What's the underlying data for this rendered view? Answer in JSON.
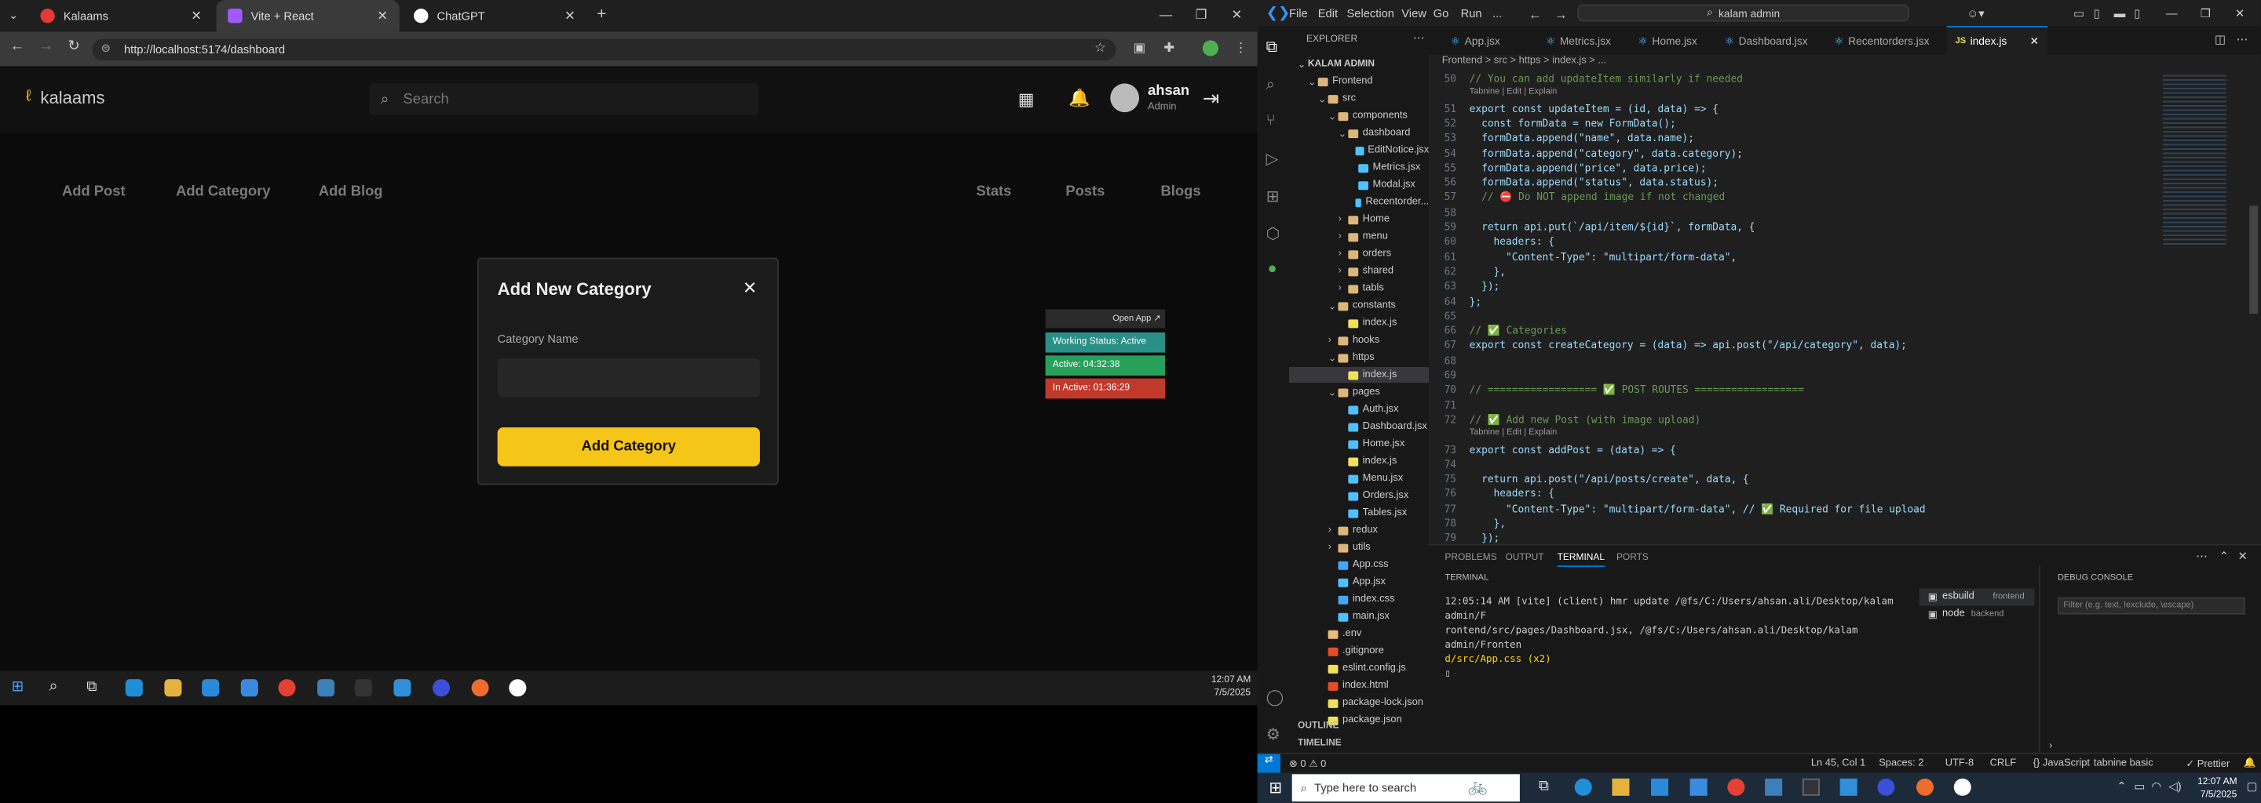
{
  "browser": {
    "tabs": [
      {
        "title": "Kalaams",
        "close": "✕"
      },
      {
        "title": "Vite + React",
        "close": "✕"
      },
      {
        "title": "ChatGPT",
        "close": "✕"
      }
    ],
    "new_tab": "+",
    "url": "http://localhost:5174/dashboard"
  },
  "app": {
    "logo": "kalaams",
    "search_placeholder": "Search",
    "user_name": "ahsan",
    "user_role": "Admin",
    "nav_left": [
      "Add Post",
      "Add Category",
      "Add Blog"
    ],
    "nav_right": [
      "Stats",
      "Posts",
      "Blogs"
    ],
    "modal": {
      "title": "Add New Category",
      "close": "✕",
      "label": "Category Name",
      "value": "",
      "button": "Add Category"
    },
    "widget": {
      "open_app": "Open App ↗",
      "status": "Working Status: Active",
      "active": "Active: 04:32:38",
      "inactive": "In Active: 01:36:29"
    },
    "colors": {
      "accent": "#f5c518",
      "green": "#27a05a",
      "red": "#c0392b",
      "teal": "#2a8f87"
    }
  },
  "taskbar_left": {
    "time": "12:07 AM",
    "date": "7/5/2025"
  },
  "vscode": {
    "menu": [
      "File",
      "Edit",
      "Selection",
      "View",
      "Go",
      "Run",
      "..."
    ],
    "search": "kalam admin",
    "tabs": [
      "App.jsx",
      "Metrics.jsx",
      "Home.jsx",
      "Dashboard.jsx",
      "Recentorders.jsx",
      "index.js"
    ],
    "breadcrumb": "Frontend > src > https > index.js > ...",
    "explorer_title": "EXPLORER",
    "tree": [
      {
        "d": 0,
        "t": "KALAM ADMIN",
        "k": "root"
      },
      {
        "d": 1,
        "t": "Frontend",
        "k": "folder"
      },
      {
        "d": 2,
        "t": "src",
        "k": "folder"
      },
      {
        "d": 3,
        "t": "components",
        "k": "folder"
      },
      {
        "d": 4,
        "t": "dashboard",
        "k": "folder"
      },
      {
        "d": 5,
        "t": "EditNotice.jsx",
        "k": "jsx"
      },
      {
        "d": 5,
        "t": "Metrics.jsx",
        "k": "jsx"
      },
      {
        "d": 5,
        "t": "Modal.jsx",
        "k": "jsx"
      },
      {
        "d": 5,
        "t": "Recentorder...",
        "k": "jsx"
      },
      {
        "d": 4,
        "t": "Home",
        "k": "folderc"
      },
      {
        "d": 4,
        "t": "menu",
        "k": "folderc"
      },
      {
        "d": 4,
        "t": "orders",
        "k": "folderc"
      },
      {
        "d": 4,
        "t": "shared",
        "k": "folderc"
      },
      {
        "d": 4,
        "t": "tabls",
        "k": "folderc"
      },
      {
        "d": 3,
        "t": "constants",
        "k": "folder"
      },
      {
        "d": 4,
        "t": "index.js",
        "k": "js"
      },
      {
        "d": 3,
        "t": "hooks",
        "k": "folderc"
      },
      {
        "d": 3,
        "t": "https",
        "k": "folder"
      },
      {
        "d": 4,
        "t": "index.js",
        "k": "js",
        "sel": true
      },
      {
        "d": 3,
        "t": "pages",
        "k": "folder"
      },
      {
        "d": 4,
        "t": "Auth.jsx",
        "k": "jsx"
      },
      {
        "d": 4,
        "t": "Dashboard.jsx",
        "k": "jsx"
      },
      {
        "d": 4,
        "t": "Home.jsx",
        "k": "jsx"
      },
      {
        "d": 4,
        "t": "index.js",
        "k": "js"
      },
      {
        "d": 4,
        "t": "Menu.jsx",
        "k": "jsx"
      },
      {
        "d": 4,
        "t": "Orders.jsx",
        "k": "jsx"
      },
      {
        "d": 4,
        "t": "Tables.jsx",
        "k": "jsx"
      },
      {
        "d": 3,
        "t": "redux",
        "k": "folderc"
      },
      {
        "d": 3,
        "t": "utils",
        "k": "folderc"
      },
      {
        "d": 3,
        "t": "App.css",
        "k": "css"
      },
      {
        "d": 3,
        "t": "App.jsx",
        "k": "jsx"
      },
      {
        "d": 3,
        "t": "index.css",
        "k": "css"
      },
      {
        "d": 3,
        "t": "main.jsx",
        "k": "jsx"
      },
      {
        "d": 2,
        "t": ".env",
        "k": "env"
      },
      {
        "d": 2,
        "t": ".gitignore",
        "k": "git"
      },
      {
        "d": 2,
        "t": "eslint.config.js",
        "k": "js"
      },
      {
        "d": 2,
        "t": "index.html",
        "k": "html"
      },
      {
        "d": 2,
        "t": "package-lock.json",
        "k": "json"
      },
      {
        "d": 2,
        "t": "package.json",
        "k": "json"
      }
    ],
    "outline": "OUTLINE",
    "timeline": "TIMELINE",
    "code": [
      [
        "50",
        "// You can add updateItem similarly if needed",
        "c"
      ],
      [
        "",
        "Tabnine | Edit | Explain",
        "h"
      ],
      [
        "51",
        "export const updateItem = (id, data) => {",
        ""
      ],
      [
        "52",
        "  const formData = new FormData();",
        ""
      ],
      [
        "53",
        "  formData.append(\"name\", data.name);",
        ""
      ],
      [
        "54",
        "  formData.append(\"category\", data.category);",
        ""
      ],
      [
        "55",
        "  formData.append(\"price\", data.price);",
        ""
      ],
      [
        "56",
        "  formData.append(\"status\", data.status);",
        ""
      ],
      [
        "57",
        "  // ⛔ Do NOT append image if not changed",
        "c"
      ],
      [
        "58",
        "",
        ""
      ],
      [
        "59",
        "  return api.put(`/api/item/${id}`, formData, {",
        ""
      ],
      [
        "60",
        "    headers: {",
        ""
      ],
      [
        "61",
        "      \"Content-Type\": \"multipart/form-data\",",
        ""
      ],
      [
        "62",
        "    },",
        ""
      ],
      [
        "63",
        "  });",
        ""
      ],
      [
        "64",
        "};",
        ""
      ],
      [
        "65",
        "",
        ""
      ],
      [
        "66",
        "// ✅ Categories",
        "c"
      ],
      [
        "67",
        "export const createCategory = (data) => api.post(\"/api/category\", data);",
        ""
      ],
      [
        "68",
        "",
        ""
      ],
      [
        "69",
        "",
        ""
      ],
      [
        "70",
        "// ================== ✅ POST ROUTES ==================",
        "c"
      ],
      [
        "71",
        "",
        ""
      ],
      [
        "72",
        "// ✅ Add new Post (with image upload)",
        "c"
      ],
      [
        "",
        "Tabnine | Edit | Explain",
        "h"
      ],
      [
        "73",
        "export const addPost = (data) => {",
        ""
      ],
      [
        "74",
        "",
        ""
      ],
      [
        "75",
        "  return api.post(\"/api/posts/create\", data, {",
        ""
      ],
      [
        "76",
        "    headers: {",
        ""
      ],
      [
        "77",
        "      \"Content-Type\": \"multipart/form-data\", // ✅ Required for file upload",
        ""
      ],
      [
        "78",
        "    },",
        ""
      ],
      [
        "79",
        "  });",
        ""
      ]
    ],
    "panel_tabs": [
      "PROBLEMS",
      "OUTPUT",
      "TERMINAL",
      "PORTS"
    ],
    "terminal_title": "TERMINAL",
    "terminal_lines": [
      "12:05:14 AM [vite] (client) hmr update /@fs/C:/Users/ahsan.ali/Desktop/kalam admin/F",
      "rontend/src/pages/Dashboard.jsx, /@fs/C:/Users/ahsan.ali/Desktop/kalam admin/Fronten",
      "d/src/App.css (x2)"
    ],
    "terminals": [
      {
        "name": "esbuild",
        "label": "frontend"
      },
      {
        "name": "node",
        "label": "backend"
      }
    ],
    "debug_title": "DEBUG CONSOLE",
    "debug_filter": "Filter (e.g. text, !exclude, \\escape)",
    "status": {
      "left": "⊗ 0 ⚠ 0",
      "right": [
        "Ln 45, Col 1",
        "Spaces: 2",
        "UTF-8",
        "CRLF",
        "{} JavaScript",
        "tabnine basic",
        "✓ Prettier"
      ]
    }
  },
  "win_taskbar": {
    "search": "Type here to search",
    "time": "12:07 AM",
    "date": "7/5/2025"
  }
}
